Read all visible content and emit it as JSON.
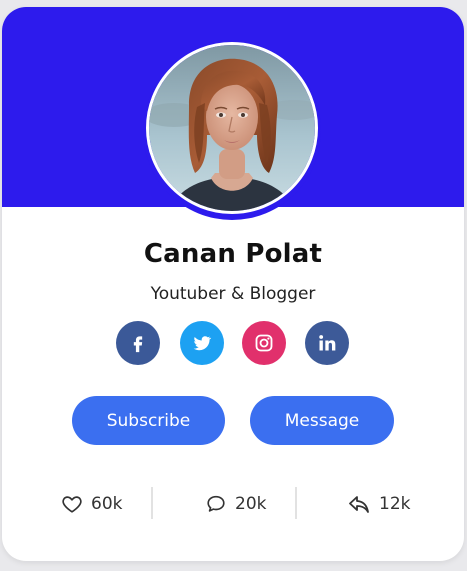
{
  "profile": {
    "name": "Canan Polat",
    "role": "Youtuber & Blogger",
    "avatar_icon": "person-portrait"
  },
  "social": [
    {
      "name": "facebook",
      "icon": "facebook-icon",
      "color": "#3b5998"
    },
    {
      "name": "twitter",
      "icon": "twitter-icon",
      "color": "#1da1f2"
    },
    {
      "name": "instagram",
      "icon": "instagram-icon",
      "color": "#e1306c"
    },
    {
      "name": "linkedin",
      "icon": "linkedin-icon",
      "color": "#3d5a98"
    }
  ],
  "actions": {
    "subscribe_label": "Subscribe",
    "message_label": "Message"
  },
  "stats": {
    "likes": "60k",
    "comments": "20k",
    "shares": "12k"
  },
  "colors": {
    "banner": "#2d1bed",
    "button": "#3b6ff0",
    "card": "#ffffff",
    "background": "#e9e9ec"
  }
}
